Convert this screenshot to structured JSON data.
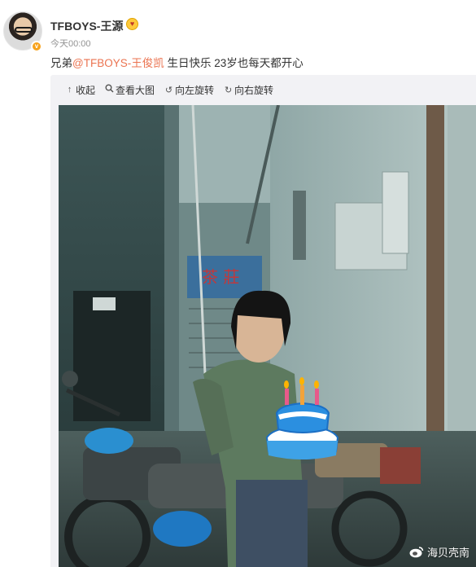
{
  "post": {
    "username": "TFBOYS-王源",
    "timestamp": "今天00:00",
    "text_prefix": "兄弟",
    "mention": "@TFBOYS-王俊凯",
    "text_suffix": " 生日快乐 23岁也每天都开心"
  },
  "toolbar": {
    "collapse": "收起",
    "view_large": "查看大图",
    "rotate_left": "向左旋转",
    "rotate_right": "向右旋转"
  },
  "photo": {
    "sign_text": "茶 莊",
    "watermark": "海贝壳南"
  },
  "colors": {
    "mention": "#eb7350",
    "media_bg": "#f2f2f5",
    "timestamp": "#939393"
  }
}
